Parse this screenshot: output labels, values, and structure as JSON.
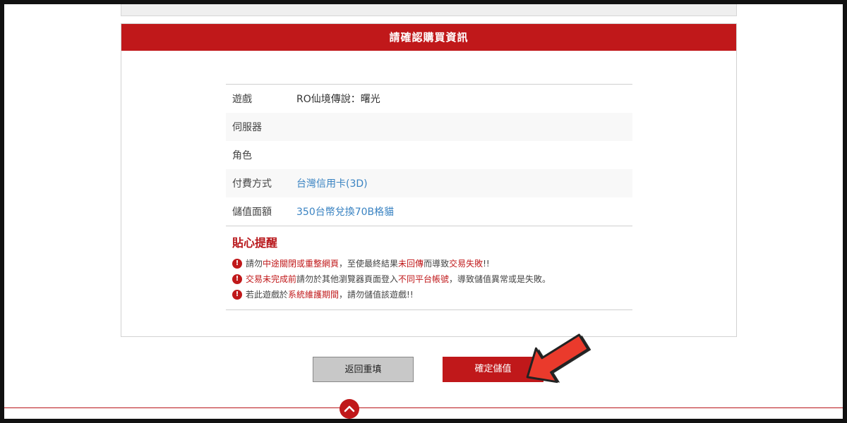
{
  "confirm_panel": {
    "title": "請確認購買資訊",
    "rows": [
      {
        "label": "遊戲",
        "value": "RO仙境傳說：曙光"
      },
      {
        "label": "伺服器",
        "value": ""
      },
      {
        "label": "角色",
        "value": ""
      },
      {
        "label": "付費方式",
        "value": "台灣信用卡(3D)"
      },
      {
        "label": "儲值面額",
        "value": "350台幣兌換70B格貓"
      }
    ]
  },
  "tips": {
    "title": "貼心提醒",
    "items": [
      {
        "p1": "請勿",
        "h1": "中途關閉或重整網頁",
        "p2": "，至使最終結果",
        "h2": "未回傳",
        "p3": "而導致",
        "h3": "交易失敗",
        "p4": "!!"
      },
      {
        "p1": "",
        "h1": "交易未完成前",
        "p2": "請勿於其他瀏覽器頁面登入",
        "h2": "不同平台帳號",
        "p3": "，導致儲值異常或是失敗。",
        "h3": "",
        "p4": ""
      },
      {
        "p1": "若此遊戲於",
        "h1": "系統維護期間",
        "p2": "，請勿儲值該遊戲!!",
        "h2": "",
        "p3": "",
        "h3": "",
        "p4": ""
      }
    ]
  },
  "buttons": {
    "back_label": "返回重填",
    "confirm_label": "確定儲值"
  },
  "icons": {
    "tip_icon": "exclamation-icon",
    "arrow": "pointer-arrow-icon",
    "scroll_top": "chevron-up-icon"
  },
  "colors": {
    "accent": "#c0181a",
    "link": "#3a83c2"
  }
}
